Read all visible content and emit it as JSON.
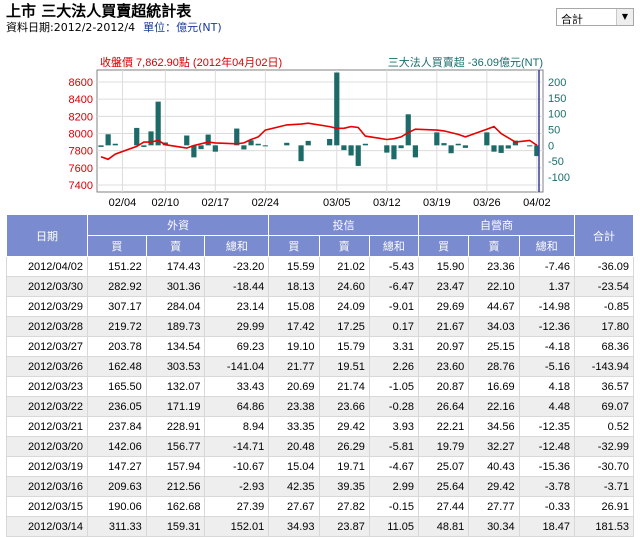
{
  "header": {
    "title": "上市 三大法人買賣超統計表",
    "date_range": "資料日期:2012/2-2012/4",
    "unit": "單位：億元(NT)"
  },
  "selector": {
    "value": "合計"
  },
  "chart_data": {
    "type": "bar+line",
    "legend_left": "收盤價 7,862.90點 (2012年04月02日)",
    "legend_right": "三大法人買賣超 -36.09億元(NT)",
    "y_left_ticks": [
      "8600",
      "8400",
      "8200",
      "8000",
      "7800",
      "7600",
      "7400"
    ],
    "y_left_range": [
      7400,
      8600
    ],
    "y_right_ticks": [
      "200",
      "150",
      "100",
      "50",
      "0",
      "-50",
      "-100"
    ],
    "y_right_range": [
      -100,
      200
    ],
    "x_tick_labels": [
      {
        "label": "02/04",
        "day": 4
      },
      {
        "label": "02/10",
        "day": 10
      },
      {
        "label": "02/17",
        "day": 17
      },
      {
        "label": "02/24",
        "day": 24
      },
      {
        "label": "03/05",
        "day": 34
      },
      {
        "label": "03/12",
        "day": 41
      },
      {
        "label": "03/19",
        "day": 48
      },
      {
        "label": "03/26",
        "day": 55
      },
      {
        "label": "04/02",
        "day": 62
      }
    ],
    "days": [
      1,
      2,
      3,
      6,
      7,
      8,
      9,
      10,
      13,
      14,
      15,
      16,
      17,
      20,
      21,
      22,
      23,
      24,
      27,
      29,
      30,
      33,
      34,
      35,
      36,
      37,
      38,
      41,
      42,
      43,
      44,
      45,
      48,
      49,
      50,
      51,
      52,
      55,
      56,
      57,
      58,
      59,
      61,
      62
    ],
    "net_buy_sell": [
      -5,
      35,
      5,
      55,
      -5,
      44,
      138,
      9,
      31,
      -38,
      -12,
      34,
      -20,
      53,
      -13,
      16,
      5,
      -3,
      8,
      -50,
      14,
      20,
      230,
      -15,
      -32,
      -65,
      5,
      -23,
      -44,
      -9,
      98,
      -38,
      41,
      7,
      -25,
      5,
      -8,
      41,
      -20,
      -24,
      -10,
      15,
      -3,
      -34
    ],
    "close": [
      7730,
      7700,
      7760,
      7850,
      7900,
      7900,
      7920,
      7870,
      7830,
      7860,
      7880,
      7900,
      7890,
      7880,
      7890,
      7930,
      7960,
      8040,
      8100,
      8110,
      8120,
      8080,
      8060,
      8060,
      8080,
      8070,
      7970,
      7930,
      7940,
      7960,
      8010,
      8050,
      8040,
      8030,
      8010,
      7990,
      7960,
      8050,
      8080,
      8000,
      7950,
      7900,
      7920,
      7863
    ]
  },
  "table": {
    "groups": [
      "日期",
      "外資",
      "投信",
      "自營商",
      "合計"
    ],
    "subs": [
      "買",
      "賣",
      "總和",
      "買",
      "賣",
      "總和",
      "買",
      "賣",
      "總和"
    ],
    "rows": [
      [
        "2012/04/02",
        "151.22",
        "174.43",
        "-23.20",
        "15.59",
        "21.02",
        "-5.43",
        "15.90",
        "23.36",
        "-7.46",
        "-36.09"
      ],
      [
        "2012/03/30",
        "282.92",
        "301.36",
        "-18.44",
        "18.13",
        "24.60",
        "-6.47",
        "23.47",
        "22.10",
        "1.37",
        "-23.54"
      ],
      [
        "2012/03/29",
        "307.17",
        "284.04",
        "23.14",
        "15.08",
        "24.09",
        "-9.01",
        "29.69",
        "44.67",
        "-14.98",
        "-0.85"
      ],
      [
        "2012/03/28",
        "219.72",
        "189.73",
        "29.99",
        "17.42",
        "17.25",
        "0.17",
        "21.67",
        "34.03",
        "-12.36",
        "17.80"
      ],
      [
        "2012/03/27",
        "203.78",
        "134.54",
        "69.23",
        "19.10",
        "15.79",
        "3.31",
        "20.97",
        "25.15",
        "-4.18",
        "68.36"
      ],
      [
        "2012/03/26",
        "162.48",
        "303.53",
        "-141.04",
        "21.77",
        "19.51",
        "2.26",
        "23.60",
        "28.76",
        "-5.16",
        "-143.94"
      ],
      [
        "2012/03/23",
        "165.50",
        "132.07",
        "33.43",
        "20.69",
        "21.74",
        "-1.05",
        "20.87",
        "16.69",
        "4.18",
        "36.57"
      ],
      [
        "2012/03/22",
        "236.05",
        "171.19",
        "64.86",
        "23.38",
        "23.66",
        "-0.28",
        "26.64",
        "22.16",
        "4.48",
        "69.07"
      ],
      [
        "2012/03/21",
        "237.84",
        "228.91",
        "8.94",
        "33.35",
        "29.42",
        "3.93",
        "22.21",
        "34.56",
        "-12.35",
        "0.52"
      ],
      [
        "2012/03/20",
        "142.06",
        "156.77",
        "-14.71",
        "20.48",
        "26.29",
        "-5.81",
        "19.79",
        "32.27",
        "-12.48",
        "-32.99"
      ],
      [
        "2012/03/19",
        "147.27",
        "157.94",
        "-10.67",
        "15.04",
        "19.71",
        "-4.67",
        "25.07",
        "40.43",
        "-15.36",
        "-30.70"
      ],
      [
        "2012/03/16",
        "209.63",
        "212.56",
        "-2.93",
        "42.35",
        "39.35",
        "2.99",
        "25.64",
        "29.42",
        "-3.78",
        "-3.71"
      ],
      [
        "2012/03/15",
        "190.06",
        "162.68",
        "27.39",
        "27.67",
        "27.82",
        "-0.15",
        "27.44",
        "27.77",
        "-0.33",
        "26.91"
      ],
      [
        "2012/03/14",
        "311.33",
        "159.31",
        "152.01",
        "34.93",
        "23.87",
        "11.05",
        "48.81",
        "30.34",
        "18.47",
        "181.53"
      ]
    ]
  }
}
